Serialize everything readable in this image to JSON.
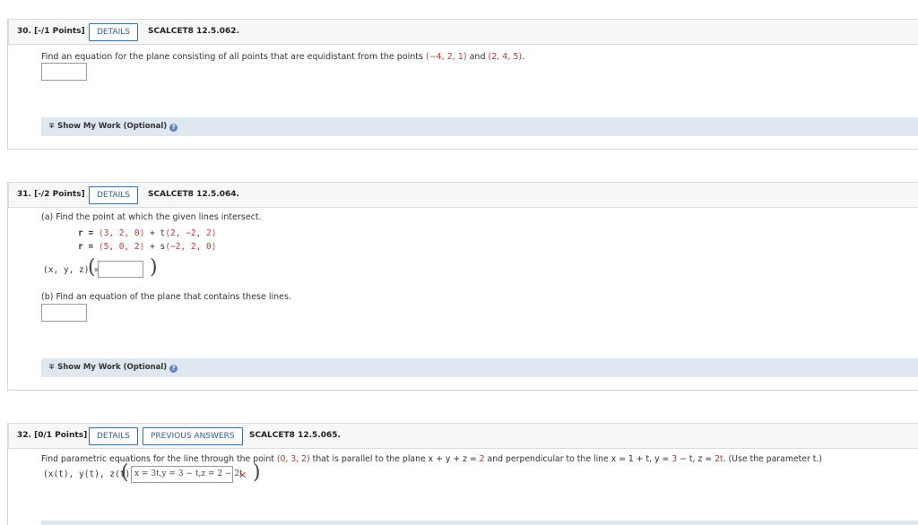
{
  "q30": {
    "number": "30. [-/1 Points]",
    "details_label": "DETAILS",
    "code": "SCALCET8 12.5.062.",
    "prompt_pre": "Find an equation for the plane consisting of all points that are equidistant from the points ",
    "point1": "(−4, 2, 1)",
    "and": " and ",
    "point2": "(2, 4, 5)",
    "period": ".",
    "show_work": "Show My Work (Optional)"
  },
  "q31": {
    "number": "31. [-/2 Points]",
    "details_label": "DETAILS",
    "code": "SCALCET8 12.5.064.",
    "part_a": "(a) Find the point at which the given lines intersect.",
    "line1_r": "r = ",
    "line1_vec": "⟨3, 2, 0⟩",
    "line1_plus": " + t",
    "line1_dir": "⟨2, −2, 2⟩",
    "line2_r": "r = ",
    "line2_vec": "⟨5, 0, 2⟩",
    "line2_plus": " + s",
    "line2_dir": "⟨−2, 2, 0⟩",
    "xyz_label": "(x, y, z) =",
    "part_b": "(b) Find an equation of the plane that contains these lines.",
    "show_work": "Show My Work (Optional)"
  },
  "q32": {
    "number": "32. [0/1 Points]",
    "details_label": "DETAILS",
    "prev_label": "PREVIOUS ANSWERS",
    "code": "SCALCET8 12.5.065.",
    "prompt_pre": "Find parametric equations for the line through the point ",
    "point": "(0, 3, 2)",
    "prompt_mid": " that is parallel to the plane  x + y + z = ",
    "plane_val": "2",
    "prompt_mid2": "  and perpendicular to the line  x = 1 + t, y = ",
    "line_y": "3",
    "prompt_mid3": " − t, z = ",
    "line_z": "2t",
    "prompt_end": ".  (Use the parameter t.)",
    "answer_label": "(x(t), y(t), z(t)) =",
    "answer_value": "x = 3t,y = 3 − t,z = 2 − 2t",
    "wrong_mark": "✕"
  }
}
